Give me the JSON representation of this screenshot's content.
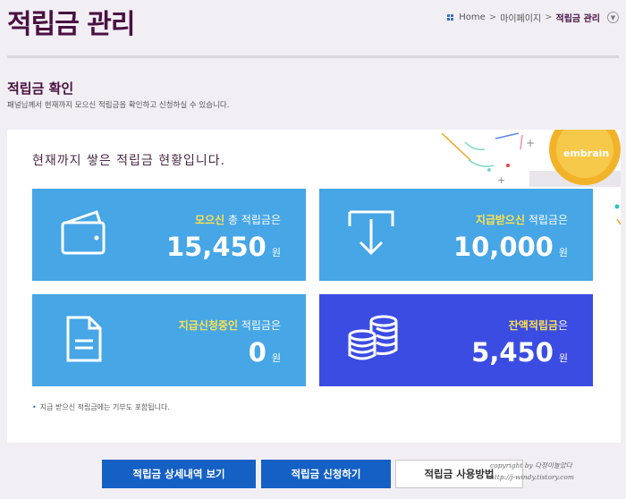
{
  "page": {
    "title": "적립금 관리"
  },
  "breadcrumb": {
    "home": "Home",
    "sep1": ">",
    "item1": "마이페이지",
    "sep2": ">",
    "current": "적립금 관리"
  },
  "section": {
    "title": "적립금 확인",
    "description": "패널님께서 현재까지 모으신 적립금을 확인하고 신청하실 수 있습니다."
  },
  "panel": {
    "heading": "현재까지 쌓은 적립금 현황입니다."
  },
  "cards": [
    {
      "highlight": "모으신",
      "label_rest": " 총 적립금은",
      "amount": "15,450",
      "unit": "원",
      "icon": "wallet-icon"
    },
    {
      "highlight": "지급받으신",
      "label_rest": " 적립금은",
      "amount": "10,000",
      "unit": "원",
      "icon": "download-arrow-icon"
    },
    {
      "highlight": "지급신청중인",
      "label_rest": " 적립금은",
      "amount": "0",
      "unit": "원",
      "icon": "document-icon"
    },
    {
      "highlight": "잔액적립금",
      "label_rest": "은",
      "amount": "5,450",
      "unit": "원",
      "icon": "coins-icon"
    }
  ],
  "note": {
    "bullet": "•",
    "text": "지급 받으신 적립금에는 기부도 포함됩니다."
  },
  "deco": {
    "brand": "embrain"
  },
  "buttons": {
    "detail": "적립금 상세내역 보기",
    "apply": "적립금 신청하기",
    "howto": "적립금 사용방법"
  },
  "watermark": {
    "line1": "copyright by 다정이놀았다",
    "line2": "http://j-windy.tistory.com"
  },
  "colors": {
    "title": "#4a1042",
    "card_blue": "#46a6e6",
    "card_indigo": "#3b4ce3",
    "highlight": "#ffe14a",
    "button": "#1560c4"
  }
}
